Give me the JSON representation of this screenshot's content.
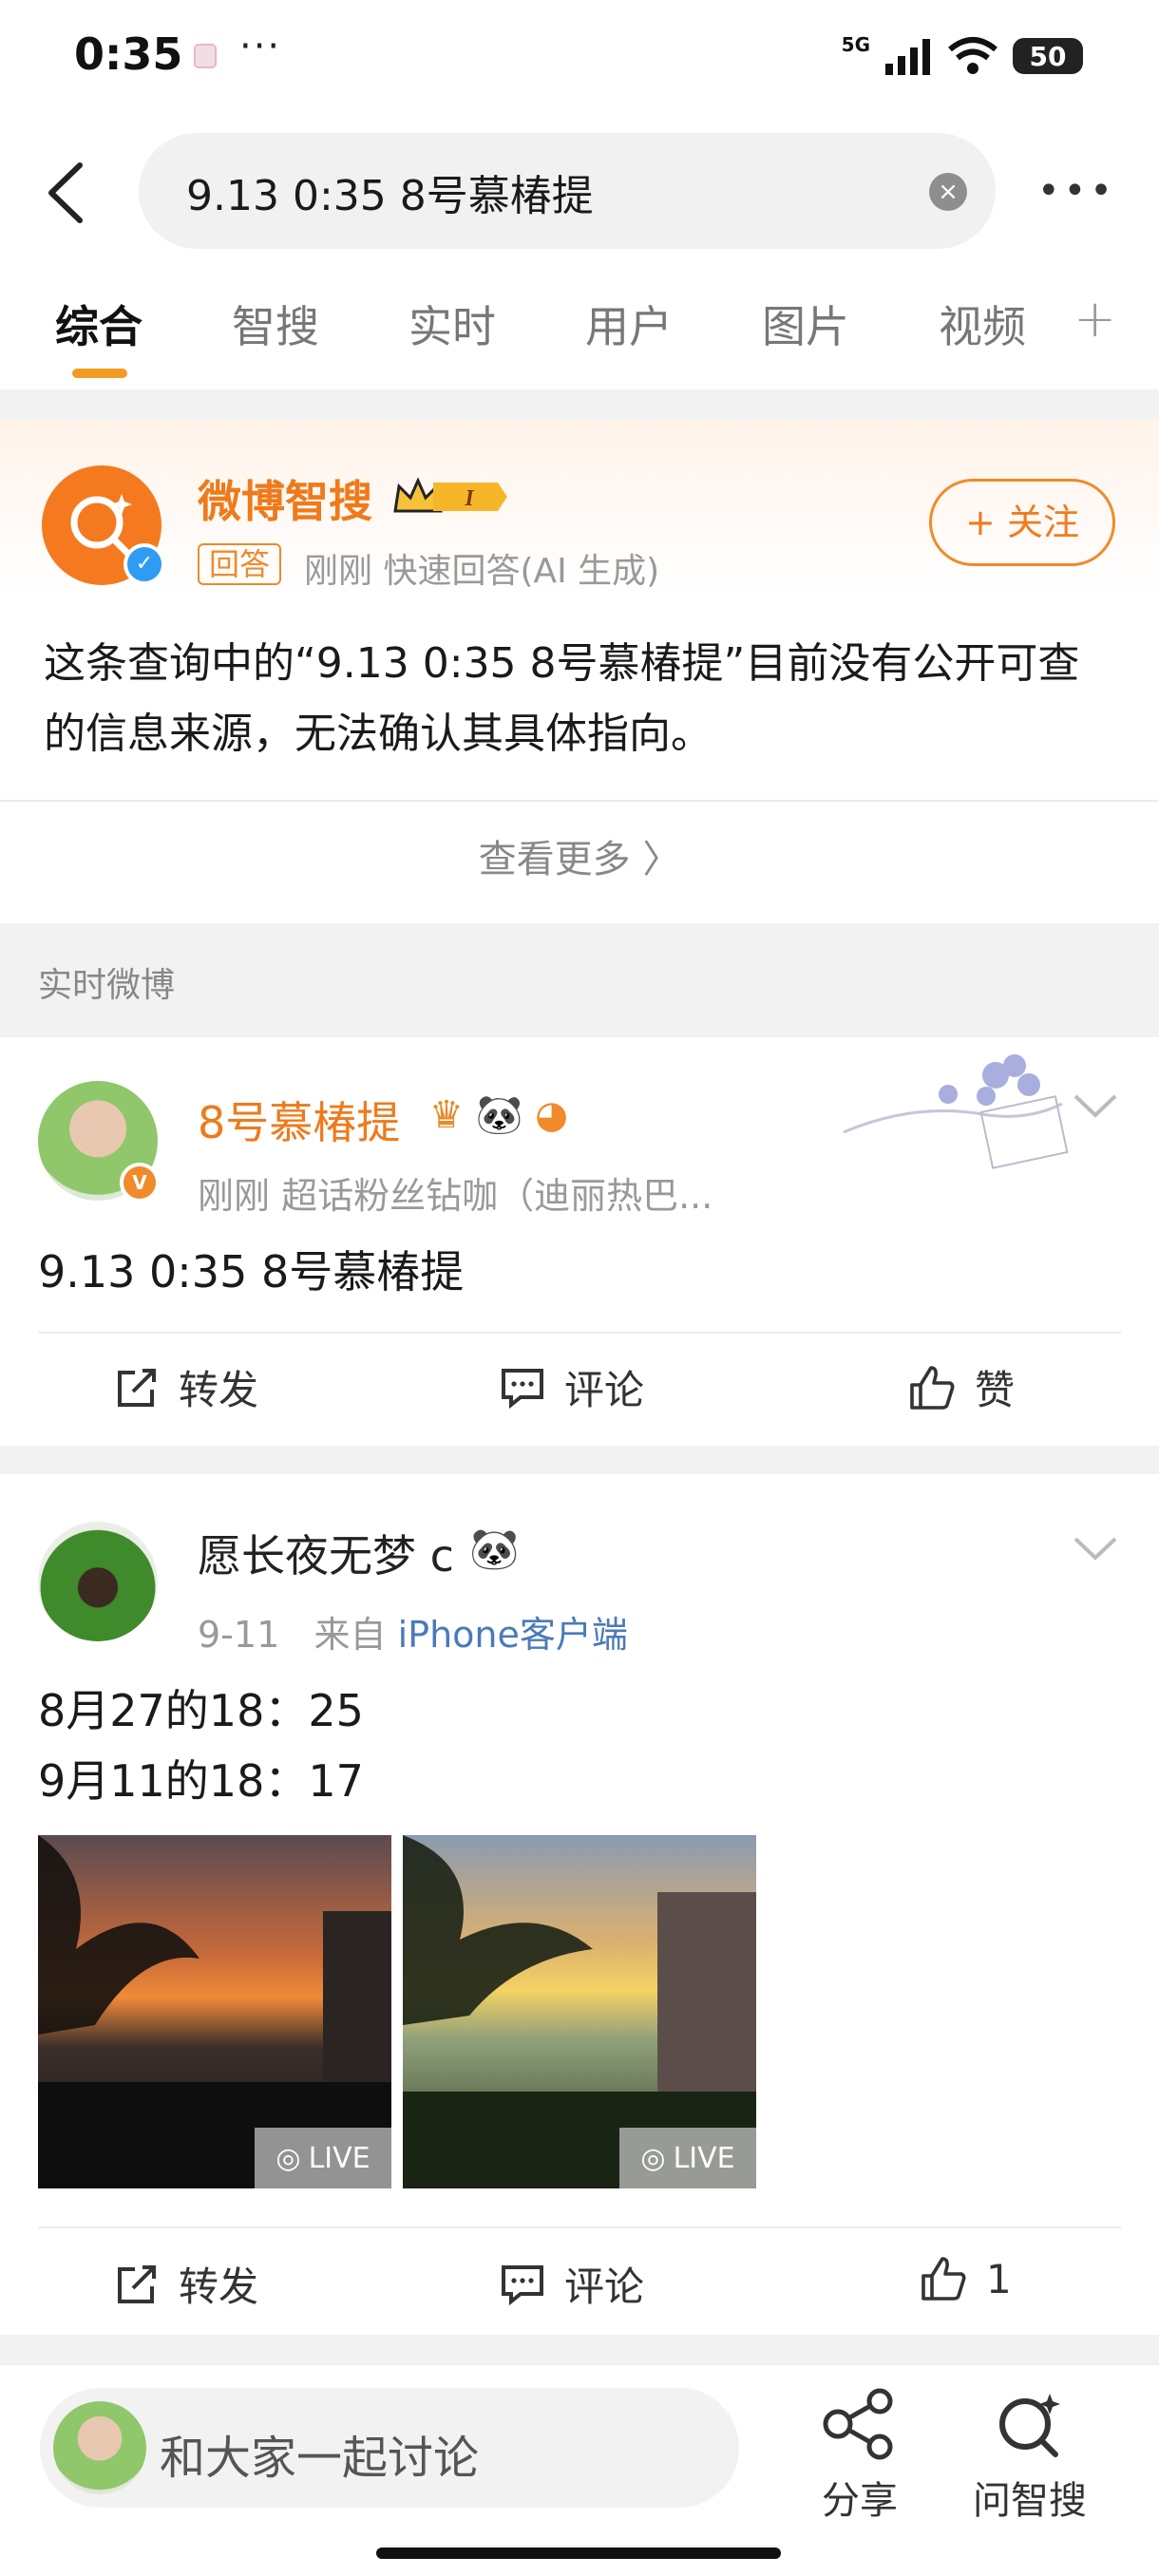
{
  "status_bar": {
    "time": "0:35",
    "more": "···",
    "network": "5G",
    "battery": "50"
  },
  "search": {
    "query": "9.13 0:35 8号慕椿提",
    "clear": "×",
    "more": "•••"
  },
  "tabs": [
    {
      "label": "综合",
      "active": true
    },
    {
      "label": "智搜",
      "active": false
    },
    {
      "label": "用户",
      "active": false
    },
    {
      "label": "实时",
      "active": false
    },
    {
      "label": "图片",
      "active": false
    },
    {
      "label": "视频",
      "active": false
    }
  ],
  "tab_add": "+",
  "ai_card": {
    "name": "微博智搜",
    "badge_level": "I",
    "tag": "回答",
    "meta": "刚刚 快速回答(AI 生成)",
    "follow_label": "+ 关注",
    "answer": "这条查询中的“9.13 0:35 8号慕椿提”目前没有公开可查的信息来源，无法确认其具体指向。",
    "view_more": "查看更多 〉"
  },
  "section_label": "实时微博",
  "posts": [
    {
      "username": "8号慕椿提",
      "username_color": "#ef7a1b",
      "meta": "刚刚   超话粉丝钻咖（迪丽热巴...",
      "text": "9.13 0:35 8号慕椿提",
      "actions": {
        "repost": "转发",
        "comment": "评论",
        "like": "赞"
      }
    },
    {
      "username": "愿长夜无梦 c",
      "username_color": "#222222",
      "meta_date": "9-11",
      "meta_from": "来自",
      "meta_source": "iPhone客户端",
      "text_lines": [
        "8月27的18：25",
        "9月11的18：17"
      ],
      "photos": [
        {
          "badge": "LIVE"
        },
        {
          "badge": "LIVE"
        }
      ],
      "actions": {
        "repost": "转发",
        "comment": "评论",
        "like": "1"
      }
    }
  ],
  "bottom_bar": {
    "comment_placeholder": "和大家一起讨论",
    "share": "分享",
    "ask": "问智搜"
  }
}
